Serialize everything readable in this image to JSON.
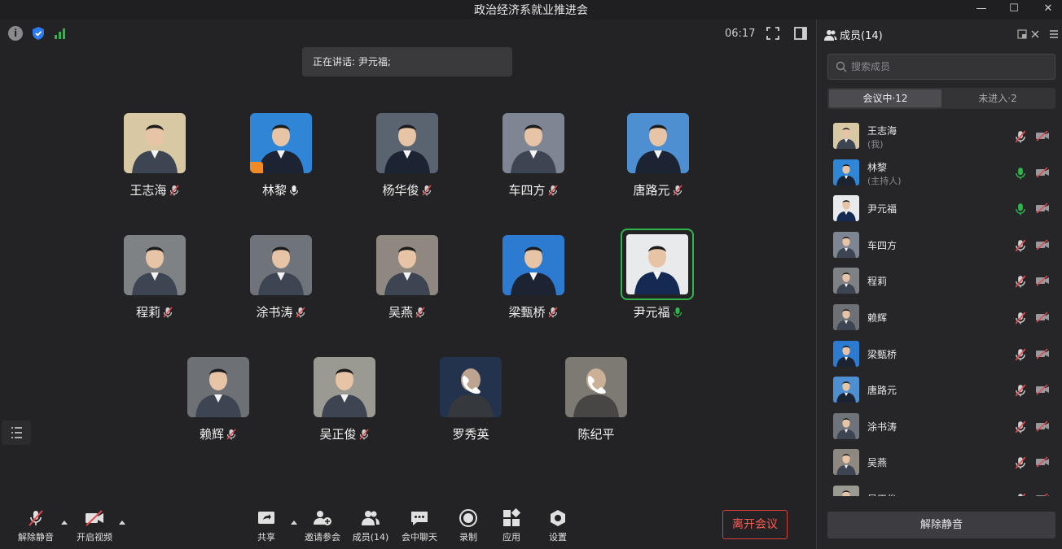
{
  "window": {
    "title": "政治经济系就业推进会",
    "minimize": "—",
    "maximize": "☐",
    "close": "✕"
  },
  "status": {
    "timer": "06:17",
    "speaking": "正在讲话: 尹元福;"
  },
  "colors": {
    "accent_green": "#2fb54a",
    "leave_red": "#d9413c",
    "bg": "#232325"
  },
  "participants": [
    {
      "name": "王志海",
      "mic": "muted",
      "active": false,
      "bg": "#d8c9a4"
    },
    {
      "name": "林黎",
      "mic": "on",
      "active": false,
      "bg": "#2f86d6",
      "host_badge": true
    },
    {
      "name": "杨华俊",
      "mic": "muted",
      "active": false,
      "bg": "#5a6470"
    },
    {
      "name": "车四方",
      "mic": "muted",
      "active": false,
      "bg": "#7d8692"
    },
    {
      "name": "唐路元",
      "mic": "muted",
      "active": false,
      "bg": "#4d8fd0"
    },
    {
      "name": "程莉",
      "mic": "muted",
      "active": false,
      "bg": "#7f8285"
    },
    {
      "name": "涂书涛",
      "mic": "muted",
      "active": false,
      "bg": "#6f747a"
    },
    {
      "name": "吴燕",
      "mic": "muted",
      "active": false,
      "bg": "#8e8880"
    },
    {
      "name": "梁甄桥",
      "mic": "muted",
      "active": false,
      "bg": "#2d7bd0"
    },
    {
      "name": "尹元福",
      "mic": "speaking",
      "active": true,
      "bg": "#e9eaec"
    },
    {
      "name": "赖辉",
      "mic": "muted",
      "active": false,
      "bg": "#6d7176"
    },
    {
      "name": "吴正俊",
      "mic": "muted",
      "active": false,
      "bg": "#9b9a92"
    },
    {
      "name": "罗秀英",
      "mic": "phone",
      "active": false,
      "bg": "#23324d"
    },
    {
      "name": "陈纪平",
      "mic": "phone",
      "active": false,
      "bg": "#7d7a74"
    }
  ],
  "toolbar": {
    "unmute": "解除静音",
    "start_video": "开启视频",
    "share": "共享",
    "invite": "邀请参会",
    "members": "成员(14)",
    "chat": "会中聊天",
    "record": "录制",
    "apps": "应用",
    "settings": "设置",
    "leave": "离开会议"
  },
  "panel": {
    "title": "成员(14)",
    "search_placeholder": "搜索成员",
    "tab_in": "会议中·12",
    "tab_out": "未进入·2",
    "members": [
      {
        "name": "王志海",
        "sub": "(我)",
        "mic": "muted",
        "bg": "#d8c9a4"
      },
      {
        "name": "林黎",
        "sub": "(主持人)",
        "mic": "on",
        "bg": "#2f86d6"
      },
      {
        "name": "尹元福",
        "sub": "",
        "mic": "on",
        "bg": "#e9eaec"
      },
      {
        "name": "车四方",
        "sub": "",
        "mic": "muted",
        "bg": "#7d8692"
      },
      {
        "name": "程莉",
        "sub": "",
        "mic": "muted",
        "bg": "#7f8285"
      },
      {
        "name": "赖辉",
        "sub": "",
        "mic": "muted",
        "bg": "#6d7176"
      },
      {
        "name": "梁甄桥",
        "sub": "",
        "mic": "muted",
        "bg": "#2d7bd0"
      },
      {
        "name": "唐路元",
        "sub": "",
        "mic": "muted",
        "bg": "#4d8fd0"
      },
      {
        "name": "涂书涛",
        "sub": "",
        "mic": "muted",
        "bg": "#6f747a"
      },
      {
        "name": "吴燕",
        "sub": "",
        "mic": "muted",
        "bg": "#8e8880"
      },
      {
        "name": "吴正俊",
        "sub": "",
        "mic": "muted",
        "bg": "#9b9a92"
      }
    ],
    "unmute_all": "解除静音"
  }
}
